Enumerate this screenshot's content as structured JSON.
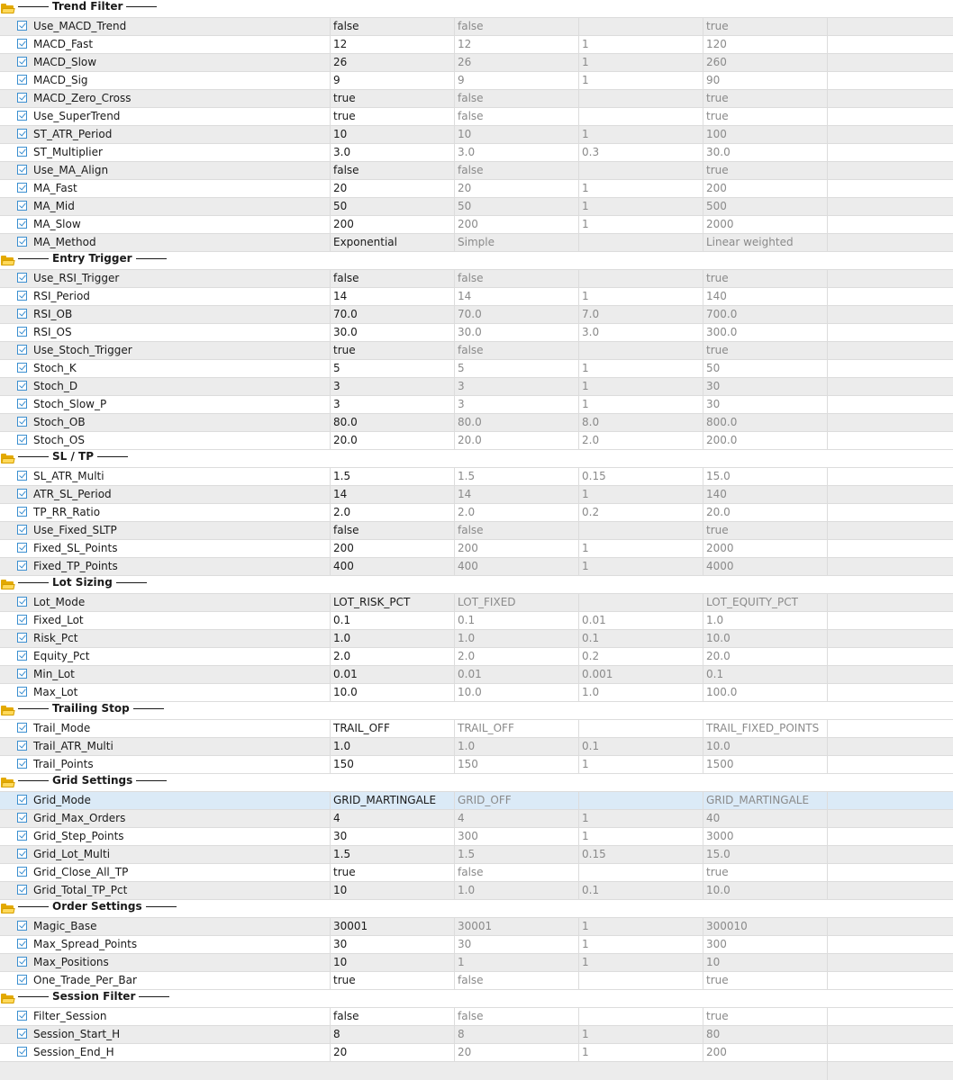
{
  "groups": [
    {
      "title": "Trend Filter",
      "rows": [
        {
          "name": "Use_MACD_Trend",
          "value": "false",
          "start": "false",
          "step": "",
          "stop": "true"
        },
        {
          "name": "MACD_Fast",
          "value": "12",
          "start": "12",
          "step": "1",
          "stop": "120"
        },
        {
          "name": "MACD_Slow",
          "value": "26",
          "start": "26",
          "step": "1",
          "stop": "260"
        },
        {
          "name": "MACD_Sig",
          "value": "9",
          "start": "9",
          "step": "1",
          "stop": "90"
        },
        {
          "name": "MACD_Zero_Cross",
          "value": "true",
          "start": "false",
          "step": "",
          "stop": "true"
        },
        {
          "name": "Use_SuperTrend",
          "value": "true",
          "start": "false",
          "step": "",
          "stop": "true"
        },
        {
          "name": "ST_ATR_Period",
          "value": "10",
          "start": "10",
          "step": "1",
          "stop": "100"
        },
        {
          "name": "ST_Multiplier",
          "value": "3.0",
          "start": "3.0",
          "step": "0.3",
          "stop": "30.0"
        },
        {
          "name": "Use_MA_Align",
          "value": "false",
          "start": "false",
          "step": "",
          "stop": "true"
        },
        {
          "name": "MA_Fast",
          "value": "20",
          "start": "20",
          "step": "1",
          "stop": "200"
        },
        {
          "name": "MA_Mid",
          "value": "50",
          "start": "50",
          "step": "1",
          "stop": "500"
        },
        {
          "name": "MA_Slow",
          "value": "200",
          "start": "200",
          "step": "1",
          "stop": "2000"
        },
        {
          "name": "MA_Method",
          "value": "Exponential",
          "start": "Simple",
          "step": "",
          "stop": "Linear weighted"
        }
      ]
    },
    {
      "title": "Entry Trigger",
      "rows": [
        {
          "name": "Use_RSI_Trigger",
          "value": "false",
          "start": "false",
          "step": "",
          "stop": "true"
        },
        {
          "name": "RSI_Period",
          "value": "14",
          "start": "14",
          "step": "1",
          "stop": "140"
        },
        {
          "name": "RSI_OB",
          "value": "70.0",
          "start": "70.0",
          "step": "7.0",
          "stop": "700.0"
        },
        {
          "name": "RSI_OS",
          "value": "30.0",
          "start": "30.0",
          "step": "3.0",
          "stop": "300.0"
        },
        {
          "name": "Use_Stoch_Trigger",
          "value": "true",
          "start": "false",
          "step": "",
          "stop": "true"
        },
        {
          "name": "Stoch_K",
          "value": "5",
          "start": "5",
          "step": "1",
          "stop": "50"
        },
        {
          "name": "Stoch_D",
          "value": "3",
          "start": "3",
          "step": "1",
          "stop": "30"
        },
        {
          "name": "Stoch_Slow_P",
          "value": "3",
          "start": "3",
          "step": "1",
          "stop": "30"
        },
        {
          "name": "Stoch_OB",
          "value": "80.0",
          "start": "80.0",
          "step": "8.0",
          "stop": "800.0"
        },
        {
          "name": "Stoch_OS",
          "value": "20.0",
          "start": "20.0",
          "step": "2.0",
          "stop": "200.0"
        }
      ]
    },
    {
      "title": "SL / TP",
      "rows": [
        {
          "name": "SL_ATR_Multi",
          "value": "1.5",
          "start": "1.5",
          "step": "0.15",
          "stop": "15.0"
        },
        {
          "name": "ATR_SL_Period",
          "value": "14",
          "start": "14",
          "step": "1",
          "stop": "140"
        },
        {
          "name": "TP_RR_Ratio",
          "value": "2.0",
          "start": "2.0",
          "step": "0.2",
          "stop": "20.0"
        },
        {
          "name": "Use_Fixed_SLTP",
          "value": "false",
          "start": "false",
          "step": "",
          "stop": "true"
        },
        {
          "name": "Fixed_SL_Points",
          "value": "200",
          "start": "200",
          "step": "1",
          "stop": "2000"
        },
        {
          "name": "Fixed_TP_Points",
          "value": "400",
          "start": "400",
          "step": "1",
          "stop": "4000"
        }
      ]
    },
    {
      "title": "Lot Sizing",
      "rows": [
        {
          "name": "Lot_Mode",
          "value": "LOT_RISK_PCT",
          "start": "LOT_FIXED",
          "step": "",
          "stop": "LOT_EQUITY_PCT"
        },
        {
          "name": "Fixed_Lot",
          "value": "0.1",
          "start": "0.1",
          "step": "0.01",
          "stop": "1.0"
        },
        {
          "name": "Risk_Pct",
          "value": "1.0",
          "start": "1.0",
          "step": "0.1",
          "stop": "10.0"
        },
        {
          "name": "Equity_Pct",
          "value": "2.0",
          "start": "2.0",
          "step": "0.2",
          "stop": "20.0"
        },
        {
          "name": "Min_Lot",
          "value": "0.01",
          "start": "0.01",
          "step": "0.001",
          "stop": "0.1"
        },
        {
          "name": "Max_Lot",
          "value": "10.0",
          "start": "10.0",
          "step": "1.0",
          "stop": "100.0"
        }
      ]
    },
    {
      "title": "Trailing Stop",
      "rows": [
        {
          "name": "Trail_Mode",
          "value": "TRAIL_OFF",
          "start": "TRAIL_OFF",
          "step": "",
          "stop": "TRAIL_FIXED_POINTS"
        },
        {
          "name": "Trail_ATR_Multi",
          "value": "1.0",
          "start": "1.0",
          "step": "0.1",
          "stop": "10.0"
        },
        {
          "name": "Trail_Points",
          "value": "150",
          "start": "150",
          "step": "1",
          "stop": "1500"
        }
      ]
    },
    {
      "title": "Grid Settings",
      "rows": [
        {
          "name": "Grid_Mode",
          "value": "GRID_MARTINGALE",
          "start": "GRID_OFF",
          "step": "",
          "stop": "GRID_MARTINGALE",
          "selected": true
        },
        {
          "name": "Grid_Max_Orders",
          "value": "4",
          "start": "4",
          "step": "1",
          "stop": "40"
        },
        {
          "name": "Grid_Step_Points",
          "value": "30",
          "start": "300",
          "step": "1",
          "stop": "3000"
        },
        {
          "name": "Grid_Lot_Multi",
          "value": "1.5",
          "start": "1.5",
          "step": "0.15",
          "stop": "15.0"
        },
        {
          "name": "Grid_Close_All_TP",
          "value": "true",
          "start": "false",
          "step": "",
          "stop": "true"
        },
        {
          "name": "Grid_Total_TP_Pct",
          "value": "10",
          "start": "1.0",
          "step": "0.1",
          "stop": "10.0"
        }
      ]
    },
    {
      "title": "Order Settings",
      "rows": [
        {
          "name": "Magic_Base",
          "value": "30001",
          "start": "30001",
          "step": "1",
          "stop": "300010"
        },
        {
          "name": "Max_Spread_Points",
          "value": "30",
          "start": "30",
          "step": "1",
          "stop": "300"
        },
        {
          "name": "Max_Positions",
          "value": "10",
          "start": "1",
          "step": "1",
          "stop": "10"
        },
        {
          "name": "One_Trade_Per_Bar",
          "value": "true",
          "start": "false",
          "step": "",
          "stop": "true"
        }
      ]
    },
    {
      "title": "Session Filter",
      "rows": [
        {
          "name": "Filter_Session",
          "value": "false",
          "start": "false",
          "step": "",
          "stop": "true"
        },
        {
          "name": "Session_Start_H",
          "value": "8",
          "start": "8",
          "step": "1",
          "stop": "80"
        },
        {
          "name": "Session_End_H",
          "value": "20",
          "start": "20",
          "step": "1",
          "stop": "200"
        }
      ]
    }
  ],
  "colors": {
    "checkbox": "#3b8fd0",
    "folder": "#e3a900",
    "selected_row": "#dbeaf7",
    "alt_row": "#ececec",
    "dim_text": "#8a8a8a"
  },
  "icons": {
    "group": "folder-open-icon",
    "param": "checkbox-checked-icon"
  }
}
